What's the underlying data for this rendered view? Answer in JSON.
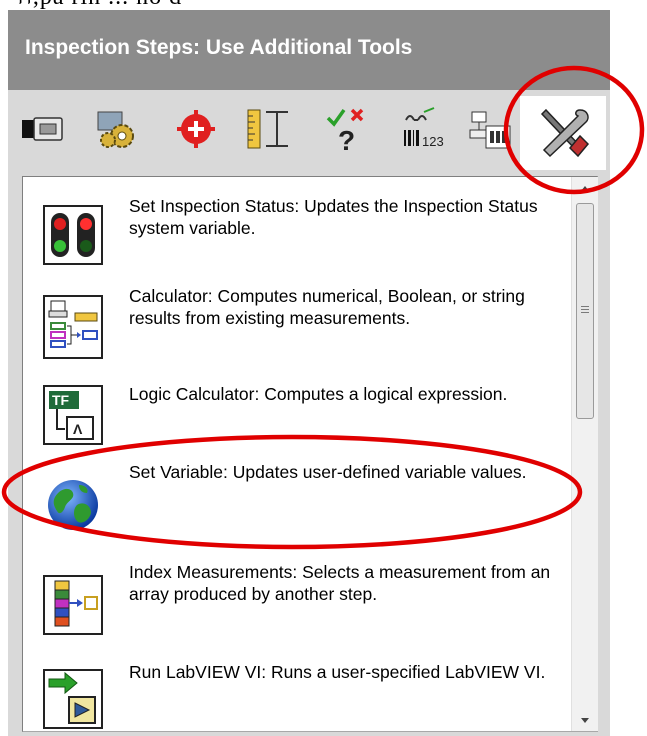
{
  "panel": {
    "title": "Inspection Steps: Use Additional Tools"
  },
  "toolbar": {
    "tools": [
      {
        "icon": "acquire-camera-icon"
      },
      {
        "icon": "enhance-image-gears-icon"
      },
      {
        "icon": "locate-features-crosshair-icon"
      },
      {
        "icon": "measure-features-ruler-icon"
      },
      {
        "icon": "check-presence-icon"
      },
      {
        "icon": "identify-parts-barcode-icon"
      },
      {
        "icon": "communicate-io-icon"
      },
      {
        "icon": "additional-tools-icon",
        "active": true
      }
    ]
  },
  "steps": [
    {
      "icon": "traffic-light-icon",
      "text": "Set Inspection Status:  Updates the Inspection Status system variable."
    },
    {
      "icon": "calculator-icon",
      "text": "Calculator:  Computes numerical, Boolean, or string results from existing measurements."
    },
    {
      "icon": "logic-calculator-icon",
      "text": "Logic Calculator:  Computes a logical expression."
    },
    {
      "icon": "globe-icon",
      "text": "Set Variable:  Updates user-defined variable values."
    },
    {
      "icon": "index-measurements-icon",
      "text": "Index Measurements:  Selects a measurement from an array produced by another step."
    },
    {
      "icon": "run-labview-vi-icon",
      "text": "Run LabVIEW VI:  Runs a user-specified LabVIEW VI."
    }
  ],
  "annotations": {
    "color": "#e00000"
  },
  "colors": {
    "header_bg": "#8c8c8c",
    "panel_bg": "#d9d9d9"
  }
}
